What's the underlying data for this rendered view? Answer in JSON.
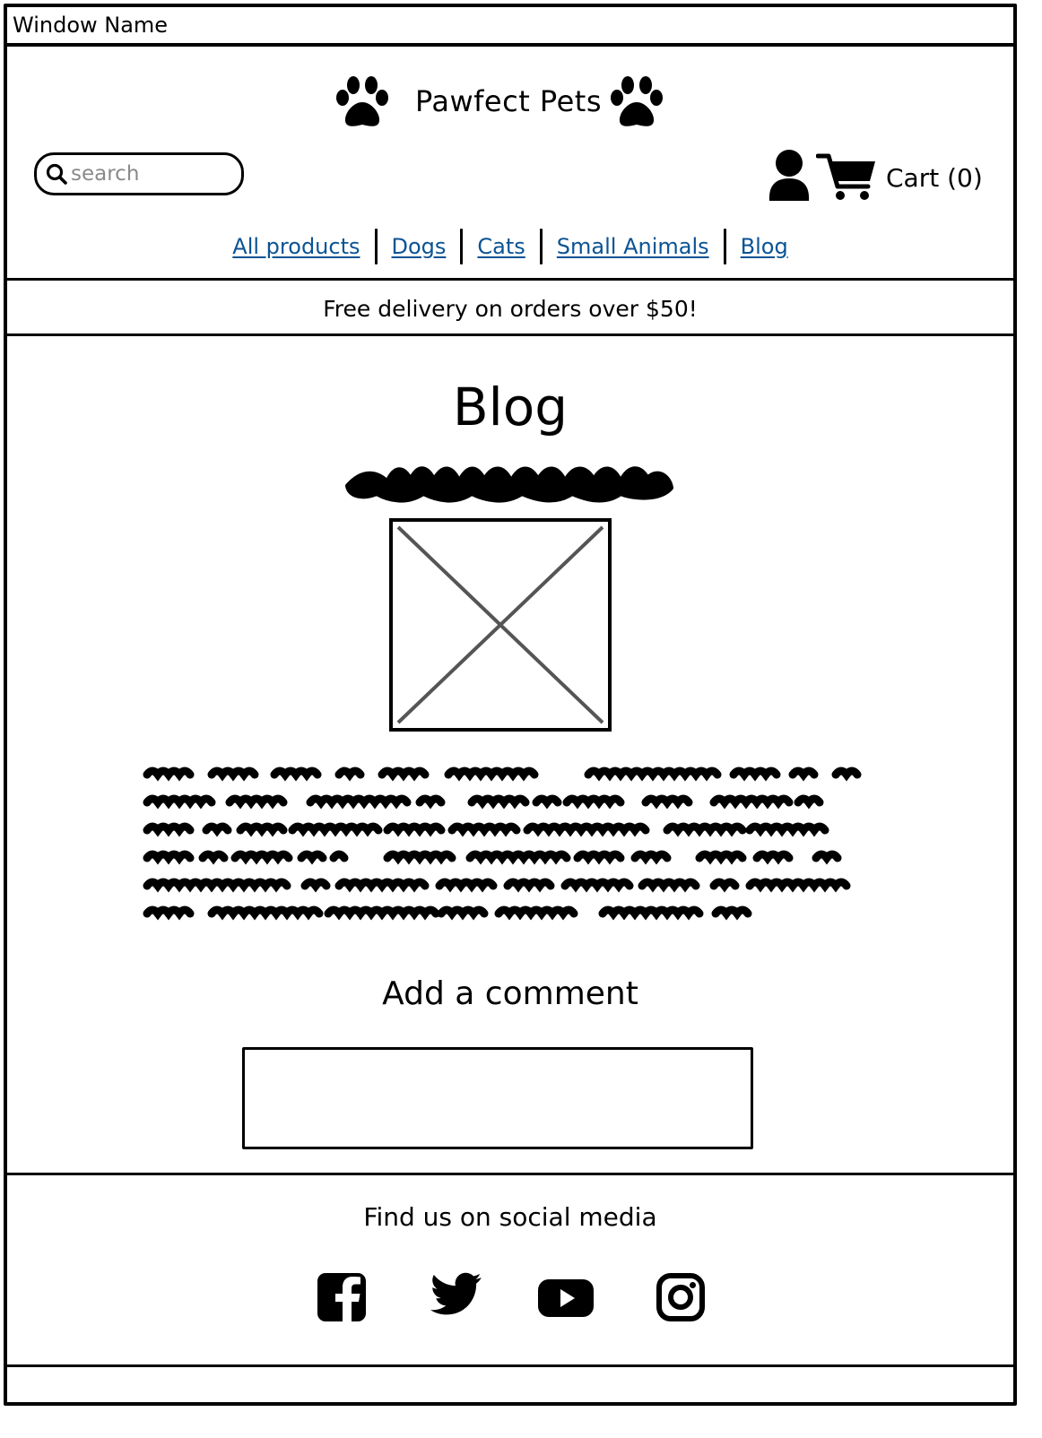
{
  "window": {
    "title": "Window Name"
  },
  "header": {
    "brand_name": "Pawfect Pets",
    "search": {
      "placeholder": "search"
    },
    "cart_label": "Cart (0)",
    "icons": [
      "paw-icon",
      "search-icon",
      "user-icon",
      "cart-icon"
    ]
  },
  "nav": {
    "items": [
      {
        "label": "All products"
      },
      {
        "label": "Dogs"
      },
      {
        "label": "Cats"
      },
      {
        "label": "Small Animals"
      },
      {
        "label": "Blog"
      }
    ],
    "link_color": "#0b5394"
  },
  "promo_banner": {
    "text": "Free delivery on orders over $50!"
  },
  "main": {
    "page_title": "Blog",
    "image": "image-placeholder",
    "comment": {
      "heading": "Add a comment",
      "value": ""
    }
  },
  "footer": {
    "heading": "Find us on social media",
    "social_icons": [
      "facebook-icon",
      "twitter-icon",
      "youtube-icon",
      "instagram-icon"
    ]
  }
}
